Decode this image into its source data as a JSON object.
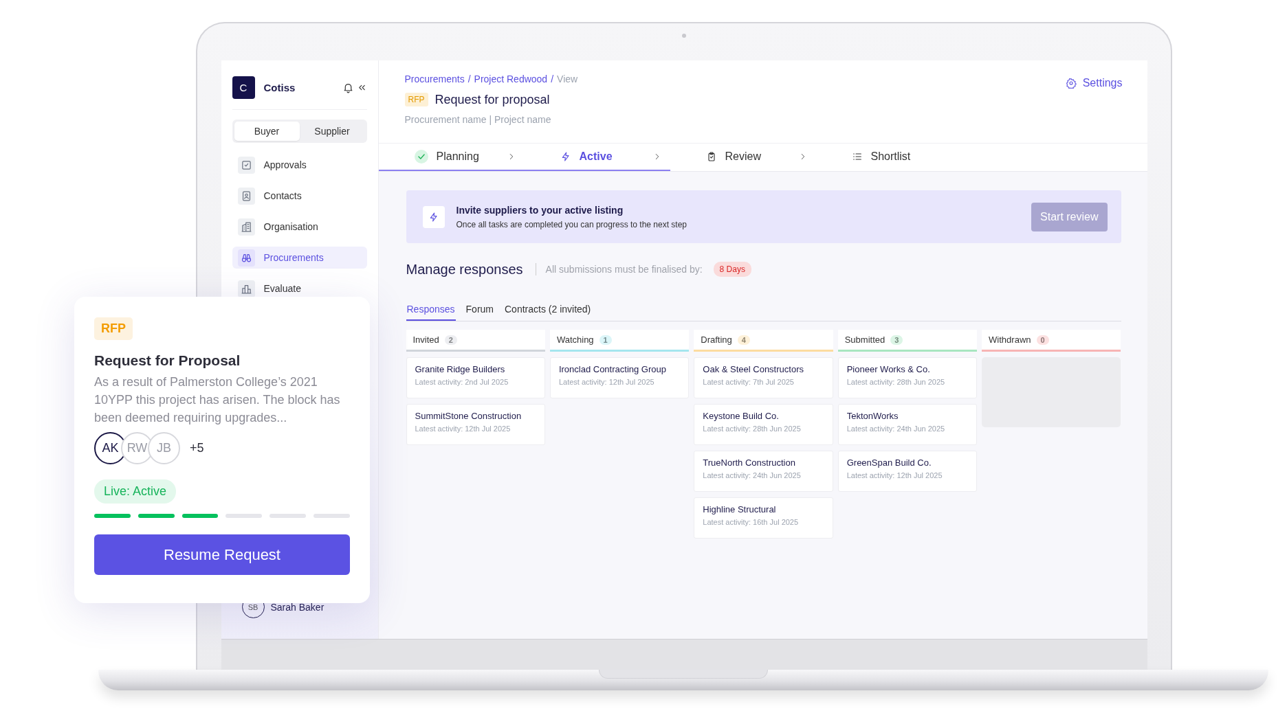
{
  "sidebar": {
    "brand": {
      "initial": "C",
      "name": "Cotiss"
    },
    "role_toggle": [
      {
        "label": "Buyer",
        "selected": true
      },
      {
        "label": "Supplier",
        "selected": false
      }
    ],
    "items": [
      {
        "label": "Approvals",
        "selected": false
      },
      {
        "label": "Contacts",
        "selected": false
      },
      {
        "label": "Organisation",
        "selected": false
      },
      {
        "label": "Procurements",
        "selected": true
      },
      {
        "label": "Evaluate",
        "selected": false
      }
    ],
    "user": {
      "initials": "SB",
      "name": "Sarah Baker"
    }
  },
  "header": {
    "breadcrumb": [
      {
        "label": "Procurements",
        "link": true
      },
      {
        "label": "Project Redwood",
        "link": true
      },
      {
        "label": "View",
        "link": false
      }
    ],
    "breadcrumb_separator": "/",
    "type_badge": "RFP",
    "title": "Request for proposal",
    "subtitle": "Procurement name | Project name",
    "settings": "Settings"
  },
  "steps": [
    {
      "label": "Planning",
      "completed": true,
      "selected": false
    },
    {
      "label": "Active",
      "completed": false,
      "selected": true
    },
    {
      "label": "Review",
      "completed": false,
      "selected": false
    },
    {
      "label": "Shortlist",
      "completed": false,
      "selected": false
    }
  ],
  "banner": {
    "title": "Invite suppliers to your active listing",
    "text": "Once all tasks are completed you can progress to the next step",
    "button": {
      "label": "Start review",
      "disabled": true
    }
  },
  "responses": {
    "title": "Manage responses",
    "deadline_label": "All submissions must be finalised by:",
    "deadline": "8 Days",
    "tabs": [
      {
        "label": "Responses",
        "selected": true
      },
      {
        "label": "Forum",
        "selected": false
      },
      {
        "label": "Contracts (2 invited)",
        "selected": false
      }
    ],
    "columns": [
      {
        "title": "Invited",
        "count": "2",
        "color": "#d1d5db",
        "cards": [
          {
            "name": "Granite Ridge Builders",
            "activity": "Latest activity: 2nd Jul 2025"
          },
          {
            "name": "SummitStone Construction",
            "activity": "Latest activity: 12th Jul 2025"
          }
        ]
      },
      {
        "title": "Watching",
        "count": "1",
        "color": "#a5e6ee",
        "cards": [
          {
            "name": "Ironclad Contracting Group",
            "activity": "Latest activity: 12th Jul 2025"
          }
        ]
      },
      {
        "title": "Drafting",
        "count": "4",
        "color": "#fcdca0",
        "cards": [
          {
            "name": "Oak & Steel Constructors",
            "activity": "Latest activity: 7th Jul 2025"
          },
          {
            "name": "Keystone Build Co.",
            "activity": "Latest activity: 28th Jun 2025"
          },
          {
            "name": "TrueNorth Construction",
            "activity": "Latest activity: 24th Jun 2025"
          },
          {
            "name": "Highline Structural",
            "activity": "Latest activity: 16th Jul 2025"
          }
        ]
      },
      {
        "title": "Submitted",
        "count": "3",
        "color": "#a8e6c0",
        "cards": [
          {
            "name": "Pioneer Works & Co.",
            "activity": "Latest activity: 28th Jun 2025"
          },
          {
            "name": "TektonWorks",
            "activity": "Latest activity: 24th Jun 2025"
          },
          {
            "name": "GreenSpan Build Co.",
            "activity": "Latest activity: 12th Jul 2025"
          }
        ]
      },
      {
        "title": "Withdrawn",
        "count": "0",
        "color": "#f7b4b4"
      }
    ]
  },
  "card": {
    "badge": "RFP",
    "title": "Request for Proposal",
    "description": "As a result of Palmerston College’s 2021 10YPP this project has arisen. The block has been deemed requiring upgrades...",
    "avatars": [
      {
        "initials": "AK",
        "active": true
      },
      {
        "initials": "RW",
        "active": false
      },
      {
        "initials": "JB",
        "active": false
      }
    ],
    "more": "+5",
    "status": "Live: Active",
    "progress": [
      {
        "done": true
      },
      {
        "done": true
      },
      {
        "done": true
      },
      {
        "done": false
      },
      {
        "done": false
      },
      {
        "done": false
      }
    ],
    "button": "Resume Request"
  }
}
